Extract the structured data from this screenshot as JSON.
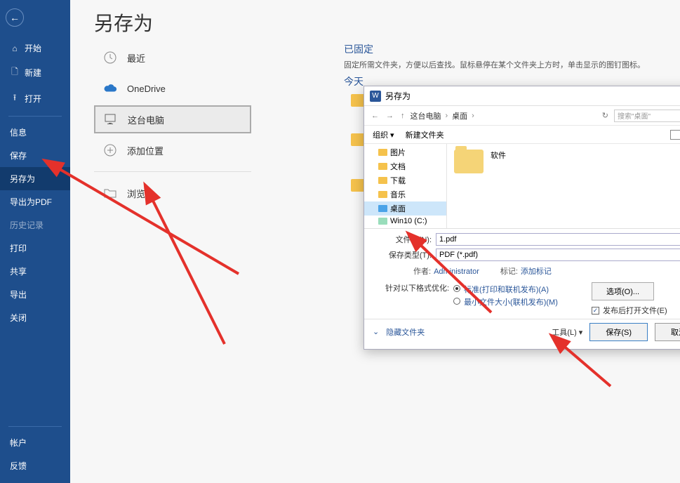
{
  "sidebar": {
    "back": "←",
    "items": [
      {
        "icon": "⌂",
        "label": "开始"
      },
      {
        "icon": "🗋",
        "label": "新建"
      },
      {
        "icon": "⭱",
        "label": "打开"
      }
    ],
    "items2": [
      {
        "label": "信息"
      },
      {
        "label": "保存"
      },
      {
        "label": "另存为",
        "active": true
      },
      {
        "label": "导出为PDF"
      },
      {
        "label": "历史记录",
        "muted": true
      },
      {
        "label": "打印"
      },
      {
        "label": "共享"
      },
      {
        "label": "导出"
      },
      {
        "label": "关闭"
      }
    ],
    "bottom": [
      {
        "label": "帐户"
      },
      {
        "label": "反馈"
      }
    ]
  },
  "page": {
    "title": "另存为"
  },
  "locations": {
    "recent": "最近",
    "onedrive": "OneDrive",
    "thispc": "这台电脑",
    "addplace": "添加位置",
    "browse": "浏览"
  },
  "pinned": {
    "heading": "已固定",
    "desc": "固定所需文件夹，方便以后查找。鼠标悬停在某个文件夹上方时，单击显示的图钉图标。"
  },
  "today": {
    "heading": "今天"
  },
  "dialog": {
    "title": "另存为",
    "crumbs": [
      "这台电脑",
      "桌面"
    ],
    "search_placeholder": "搜索\"桌面\"",
    "organize": "组织 ▾",
    "new_folder": "新建文件夹",
    "tree": [
      {
        "label": "图片"
      },
      {
        "label": "文档"
      },
      {
        "label": "下载"
      },
      {
        "label": "音乐"
      },
      {
        "label": "桌面",
        "sel": true
      },
      {
        "label": "Win10 (C:)"
      }
    ],
    "folder_item": "软件",
    "filename_label": "文件名(N):",
    "filename_value": "1.pdf",
    "filetype_label": "保存类型(T):",
    "filetype_value": "PDF (*.pdf)",
    "author_k": "作者:",
    "author_v": "Administrator",
    "tag_k": "标记:",
    "tag_v": "添加标记",
    "optimize_label": "针对以下格式优化:",
    "opt1": "标准(打印和联机发布)(A)",
    "opt2": "最小文件大小(联机发布)(M)",
    "options_btn": "选项(O)...",
    "openafter": "发布后打开文件(E)",
    "hide_folders": "隐藏文件夹",
    "tools": "工具(L) ▾",
    "save": "保存(S)",
    "cancel": "取消"
  }
}
